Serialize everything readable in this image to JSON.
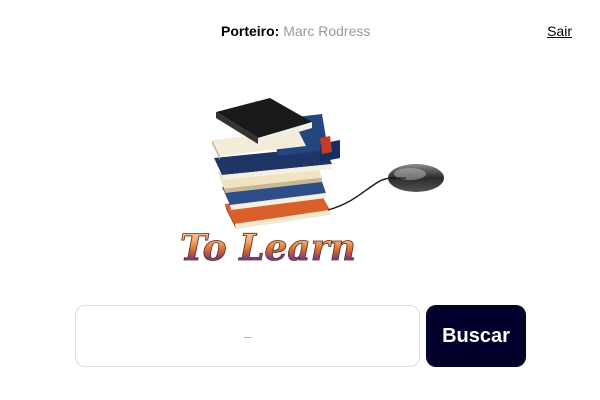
{
  "header": {
    "user_label": "Porteiro:",
    "user_name": "Marc Rodress",
    "logout_label": "Sair"
  },
  "logo": {
    "text": "To Learn"
  },
  "search": {
    "value": "",
    "placeholder": "–",
    "button_label": "Buscar"
  },
  "colors": {
    "button_bg": "#00002a",
    "user_name": "#9a9a9a"
  }
}
